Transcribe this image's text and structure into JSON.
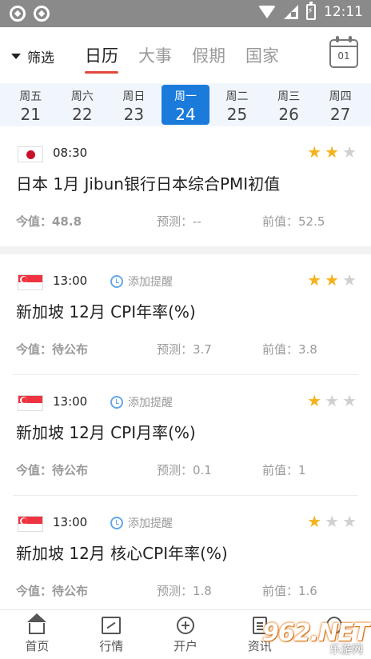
{
  "status_bar": {
    "time": "12:11"
  },
  "header": {
    "filter_label": "筛选",
    "tabs": [
      {
        "label": "日历",
        "active": true
      },
      {
        "label": "大事",
        "active": false
      },
      {
        "label": "假期",
        "active": false
      },
      {
        "label": "国家",
        "active": false
      }
    ],
    "calendar_day": "01"
  },
  "date_strip": [
    {
      "weekday": "周五",
      "day": "21"
    },
    {
      "weekday": "周六",
      "day": "22"
    },
    {
      "weekday": "周日",
      "day": "23"
    },
    {
      "weekday": "周一",
      "day": "24",
      "selected": true
    },
    {
      "weekday": "周二",
      "day": "25"
    },
    {
      "weekday": "周三",
      "day": "26"
    },
    {
      "weekday": "周四",
      "day": "27"
    }
  ],
  "events": [
    {
      "flag": "jp-flag",
      "time": "08:30",
      "reminder": "",
      "stars": 2,
      "title": "日本 1月 Jibun银行日本综合PMI初值",
      "current": "今值：48.8",
      "forecast": "预测：--",
      "previous": "前值：52.5"
    },
    {
      "flag": "sg-flag",
      "time": "13:00",
      "reminder": "添加提醒",
      "stars": 2,
      "title": "新加坡 12月 CPI年率(%)",
      "current": "今值：待公布",
      "forecast": "预测：3.7",
      "previous": "前值：3.8"
    },
    {
      "flag": "sg-flag",
      "time": "13:00",
      "reminder": "添加提醒",
      "stars": 1,
      "title": "新加坡 12月 CPI月率(%)",
      "current": "今值：待公布",
      "forecast": "预测：0.1",
      "previous": "前值：1"
    },
    {
      "flag": "sg-flag",
      "time": "13:00",
      "reminder": "添加提醒",
      "stars": 1,
      "title": "新加坡 12月 核心CPI年率(%)",
      "current": "今值：待公布",
      "forecast": "预测：1.8",
      "previous": "前值：1.6"
    }
  ],
  "bottom_nav": [
    {
      "label": "首页",
      "icon": "home-icon"
    },
    {
      "label": "行情",
      "icon": "market-icon"
    },
    {
      "label": "开户",
      "icon": "open-account-icon"
    },
    {
      "label": "资讯",
      "icon": "news-icon"
    },
    {
      "label": "",
      "icon": "profile-icon"
    }
  ],
  "watermark": {
    "logo": "962.NET",
    "sub": "乐游网"
  },
  "colors": {
    "accent_blue": "#1a7bdb",
    "tab_underline": "#e2483c",
    "star_on": "#f4b21c",
    "star_off": "#d0d0d0"
  }
}
